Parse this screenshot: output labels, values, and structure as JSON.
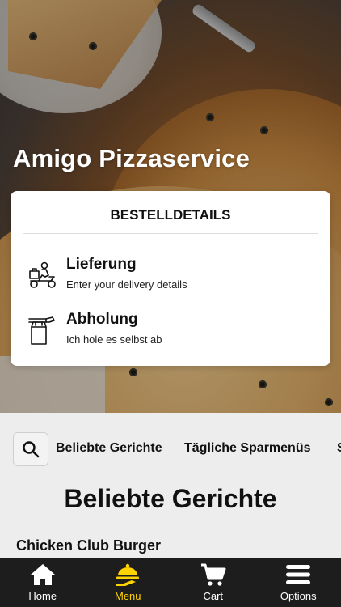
{
  "brand": {
    "name": "Amigo Pizzaservice"
  },
  "order_card": {
    "title": "BESTELLDETAILS",
    "options": [
      {
        "title": "Lieferung",
        "subtitle": "Enter your delivery details",
        "icon": "delivery-scooter-icon"
      },
      {
        "title": "Abholung",
        "subtitle": "Ich hole es selbst ab",
        "icon": "takeaway-bag-icon"
      }
    ]
  },
  "categories": {
    "search_icon": "search-icon",
    "items": [
      "Beliebte Gerichte",
      "Tägliche Sparmenüs",
      "S"
    ]
  },
  "section": {
    "title": "Beliebte Gerichte"
  },
  "dish": {
    "first_item": "Chicken Club Burger"
  },
  "tabbar": {
    "active": "Menu",
    "tabs": [
      {
        "label": "Home",
        "icon": "home-icon"
      },
      {
        "label": "Menu",
        "icon": "menu-serving-icon"
      },
      {
        "label": "Cart",
        "icon": "cart-icon"
      },
      {
        "label": "Options",
        "icon": "hamburger-icon"
      }
    ]
  },
  "colors": {
    "accent": "#ffd400",
    "tabbar_bg": "#1d1d1d",
    "card_bg": "#ffffff",
    "page_bg": "#ededed"
  }
}
